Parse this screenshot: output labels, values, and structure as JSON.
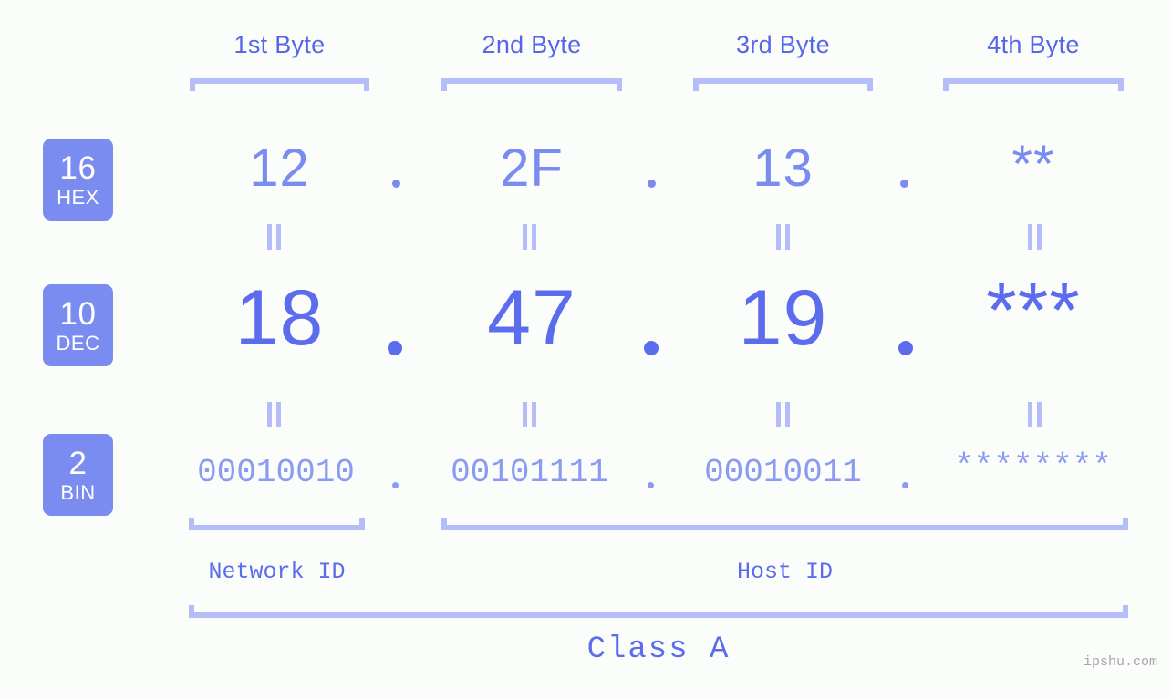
{
  "page": {
    "background_color": "#fbfdfa",
    "accent_color": "#5b6ced",
    "accent_light_color": "#b4bdf8",
    "badge_color": "#7b8cf0",
    "watermark": "ipshu.com"
  },
  "byte_headers": [
    {
      "label": "1st Byte"
    },
    {
      "label": "2nd Byte"
    },
    {
      "label": "3rd Byte"
    },
    {
      "label": "4th Byte"
    }
  ],
  "rows": [
    {
      "badge_num": "16",
      "badge_sub": "HEX",
      "values": [
        "12",
        "2F",
        "13",
        "**"
      ],
      "separator": "."
    },
    {
      "badge_num": "10",
      "badge_sub": "DEC",
      "values": [
        "18",
        "47",
        "19",
        "***"
      ],
      "separator": "."
    },
    {
      "badge_num": "2",
      "badge_sub": "BIN",
      "values": [
        "00010010",
        "00101111",
        "00010011",
        "********"
      ],
      "separator": "."
    }
  ],
  "equals_marks": {
    "glyph": "||",
    "count_per_row": 4
  },
  "sections": [
    {
      "label": "Network ID"
    },
    {
      "label": "Host ID"
    }
  ],
  "class": {
    "label": "Class A"
  }
}
